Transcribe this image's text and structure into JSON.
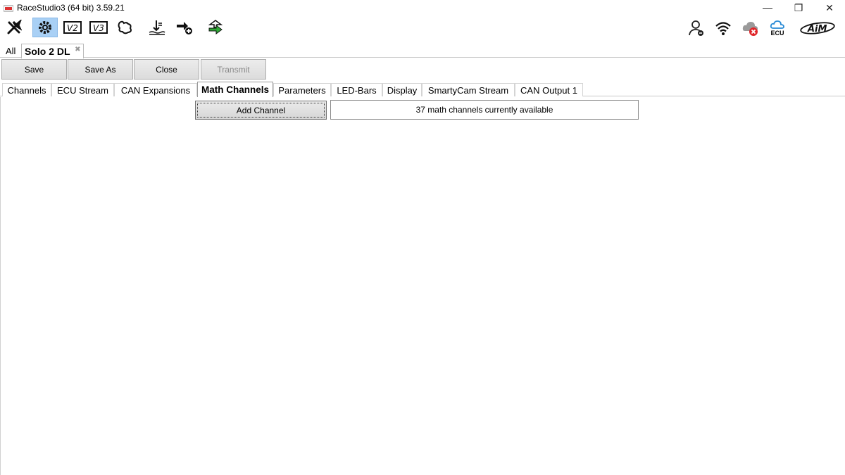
{
  "window": {
    "title": "RaceStudio3 (64 bit) 3.59.21",
    "minimize": "—",
    "restore": "❐",
    "close": "✕"
  },
  "toolbar": {
    "left_icons": [
      "wrench-icon",
      "gear-icon",
      "v2-icon",
      "v3-icon",
      "track-map-icon",
      "data-download-icon",
      "add-device-icon",
      "transfer-icon"
    ],
    "right_icons": [
      "user-icon",
      "wifi-icon",
      "cloud-error-icon",
      "ecu-cloud-icon",
      "aim-logo"
    ],
    "ecu_label": "ECU",
    "logo_text": "AiM",
    "active_color": "#a9d0f5",
    "green_accent": "#2fa836",
    "error_red": "#e0262a"
  },
  "device_tabs": {
    "all_label": "All",
    "device_label": "Solo 2 DL",
    "close_glyph": "✖"
  },
  "actions": {
    "save": "Save",
    "save_as": "Save As",
    "close": "Close",
    "transmit": "Transmit"
  },
  "section_tabs": [
    {
      "label": "Channels"
    },
    {
      "label": "ECU Stream"
    },
    {
      "label": "CAN Expansions"
    },
    {
      "label": "Math Channels",
      "active": true
    },
    {
      "label": "Parameters"
    },
    {
      "label": "LED-Bars"
    },
    {
      "label": "Display"
    },
    {
      "label": "SmartyCam Stream"
    },
    {
      "label": "CAN Output 1"
    }
  ],
  "content": {
    "add_channel_label": "Add Channel",
    "available_message": "37 math channels currently available"
  }
}
